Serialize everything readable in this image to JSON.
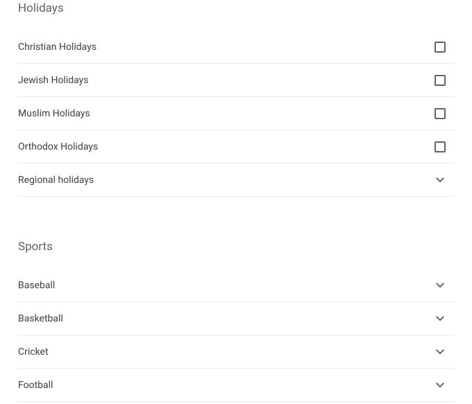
{
  "sections": [
    {
      "title": "Holidays",
      "items": [
        {
          "label": "Christian Holidays",
          "control": "checkbox",
          "checked": false
        },
        {
          "label": "Jewish Holidays",
          "control": "checkbox",
          "checked": false
        },
        {
          "label": "Muslim Holidays",
          "control": "checkbox",
          "checked": false
        },
        {
          "label": "Orthodox Holidays",
          "control": "checkbox",
          "checked": false
        },
        {
          "label": "Regional holidays",
          "control": "expand"
        }
      ]
    },
    {
      "title": "Sports",
      "items": [
        {
          "label": "Baseball",
          "control": "expand"
        },
        {
          "label": "Basketball",
          "control": "expand"
        },
        {
          "label": "Cricket",
          "control": "expand"
        },
        {
          "label": "Football",
          "control": "expand"
        }
      ]
    }
  ]
}
